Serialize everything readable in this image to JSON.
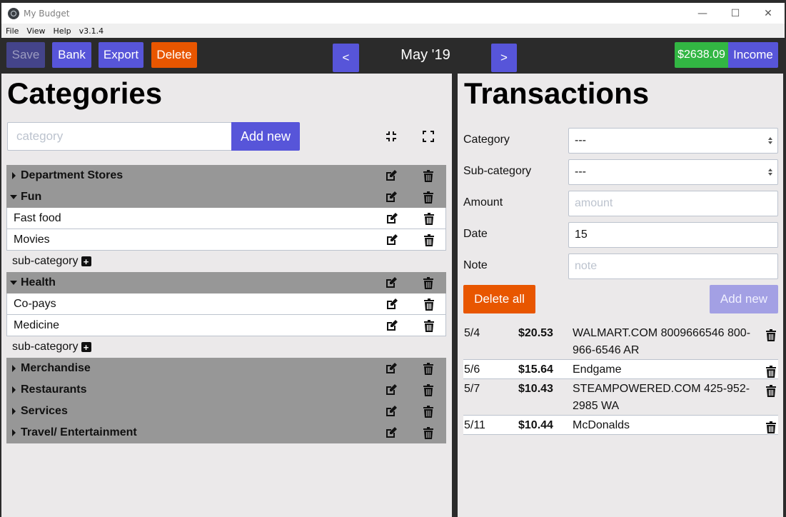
{
  "window": {
    "title": "My Budget",
    "controls": {
      "minimize": "—",
      "maximize": "☐",
      "close": "✕"
    }
  },
  "menu": [
    "File",
    "View",
    "Help",
    "v3.1.4"
  ],
  "toolbar": {
    "save_label": "Save",
    "bank_label": "Bank",
    "export_label": "Export",
    "delete_label": "Delete",
    "prev_label": "<",
    "month_label": "May '19",
    "next_label": ">",
    "balance": "$2638.09",
    "income_label": "Income"
  },
  "categories_panel": {
    "title": "Categories",
    "input_placeholder": "category",
    "add_label": "Add new",
    "subcategory_add_label": "sub-category",
    "categories": [
      {
        "name": "Department Stores",
        "expanded": false,
        "subcategories": []
      },
      {
        "name": "Fun",
        "expanded": true,
        "subcategories": [
          "Fast food",
          "Movies"
        ]
      },
      {
        "name": "Health",
        "expanded": true,
        "subcategories": [
          "Co-pays",
          "Medicine"
        ]
      },
      {
        "name": "Merchandise",
        "expanded": false,
        "subcategories": []
      },
      {
        "name": "Restaurants",
        "expanded": false,
        "subcategories": []
      },
      {
        "name": "Services",
        "expanded": false,
        "subcategories": []
      },
      {
        "name": "Travel/ Entertainment",
        "expanded": false,
        "subcategories": []
      }
    ]
  },
  "transactions_panel": {
    "title": "Transactions",
    "form": {
      "category_label": "Category",
      "category_value": "---",
      "subcategory_label": "Sub-category",
      "subcategory_value": "---",
      "amount_label": "Amount",
      "amount_placeholder": "amount",
      "date_label": "Date",
      "date_value": "15",
      "note_label": "Note",
      "note_placeholder": "note"
    },
    "delete_all_label": "Delete all",
    "add_new_label": "Add new",
    "transactions": [
      {
        "date": "5/4",
        "amount": "$20.53",
        "description": "WALMART.COM 8009666546 800-966-6546 AR"
      },
      {
        "date": "5/6",
        "amount": "$15.64",
        "description": "Endgame"
      },
      {
        "date": "5/7",
        "amount": "$10.43",
        "description": "STEAMPOWERED.COM 425-952-2985 WA"
      },
      {
        "date": "5/11",
        "amount": "$10.44",
        "description": "McDonalds"
      }
    ]
  },
  "colors": {
    "primary": "#5755d9",
    "danger": "#e85600",
    "success": "#32b643",
    "panel_bg": "#ebe9ea",
    "category_row_bg": "#979797",
    "frame": "#2b2b2b"
  }
}
